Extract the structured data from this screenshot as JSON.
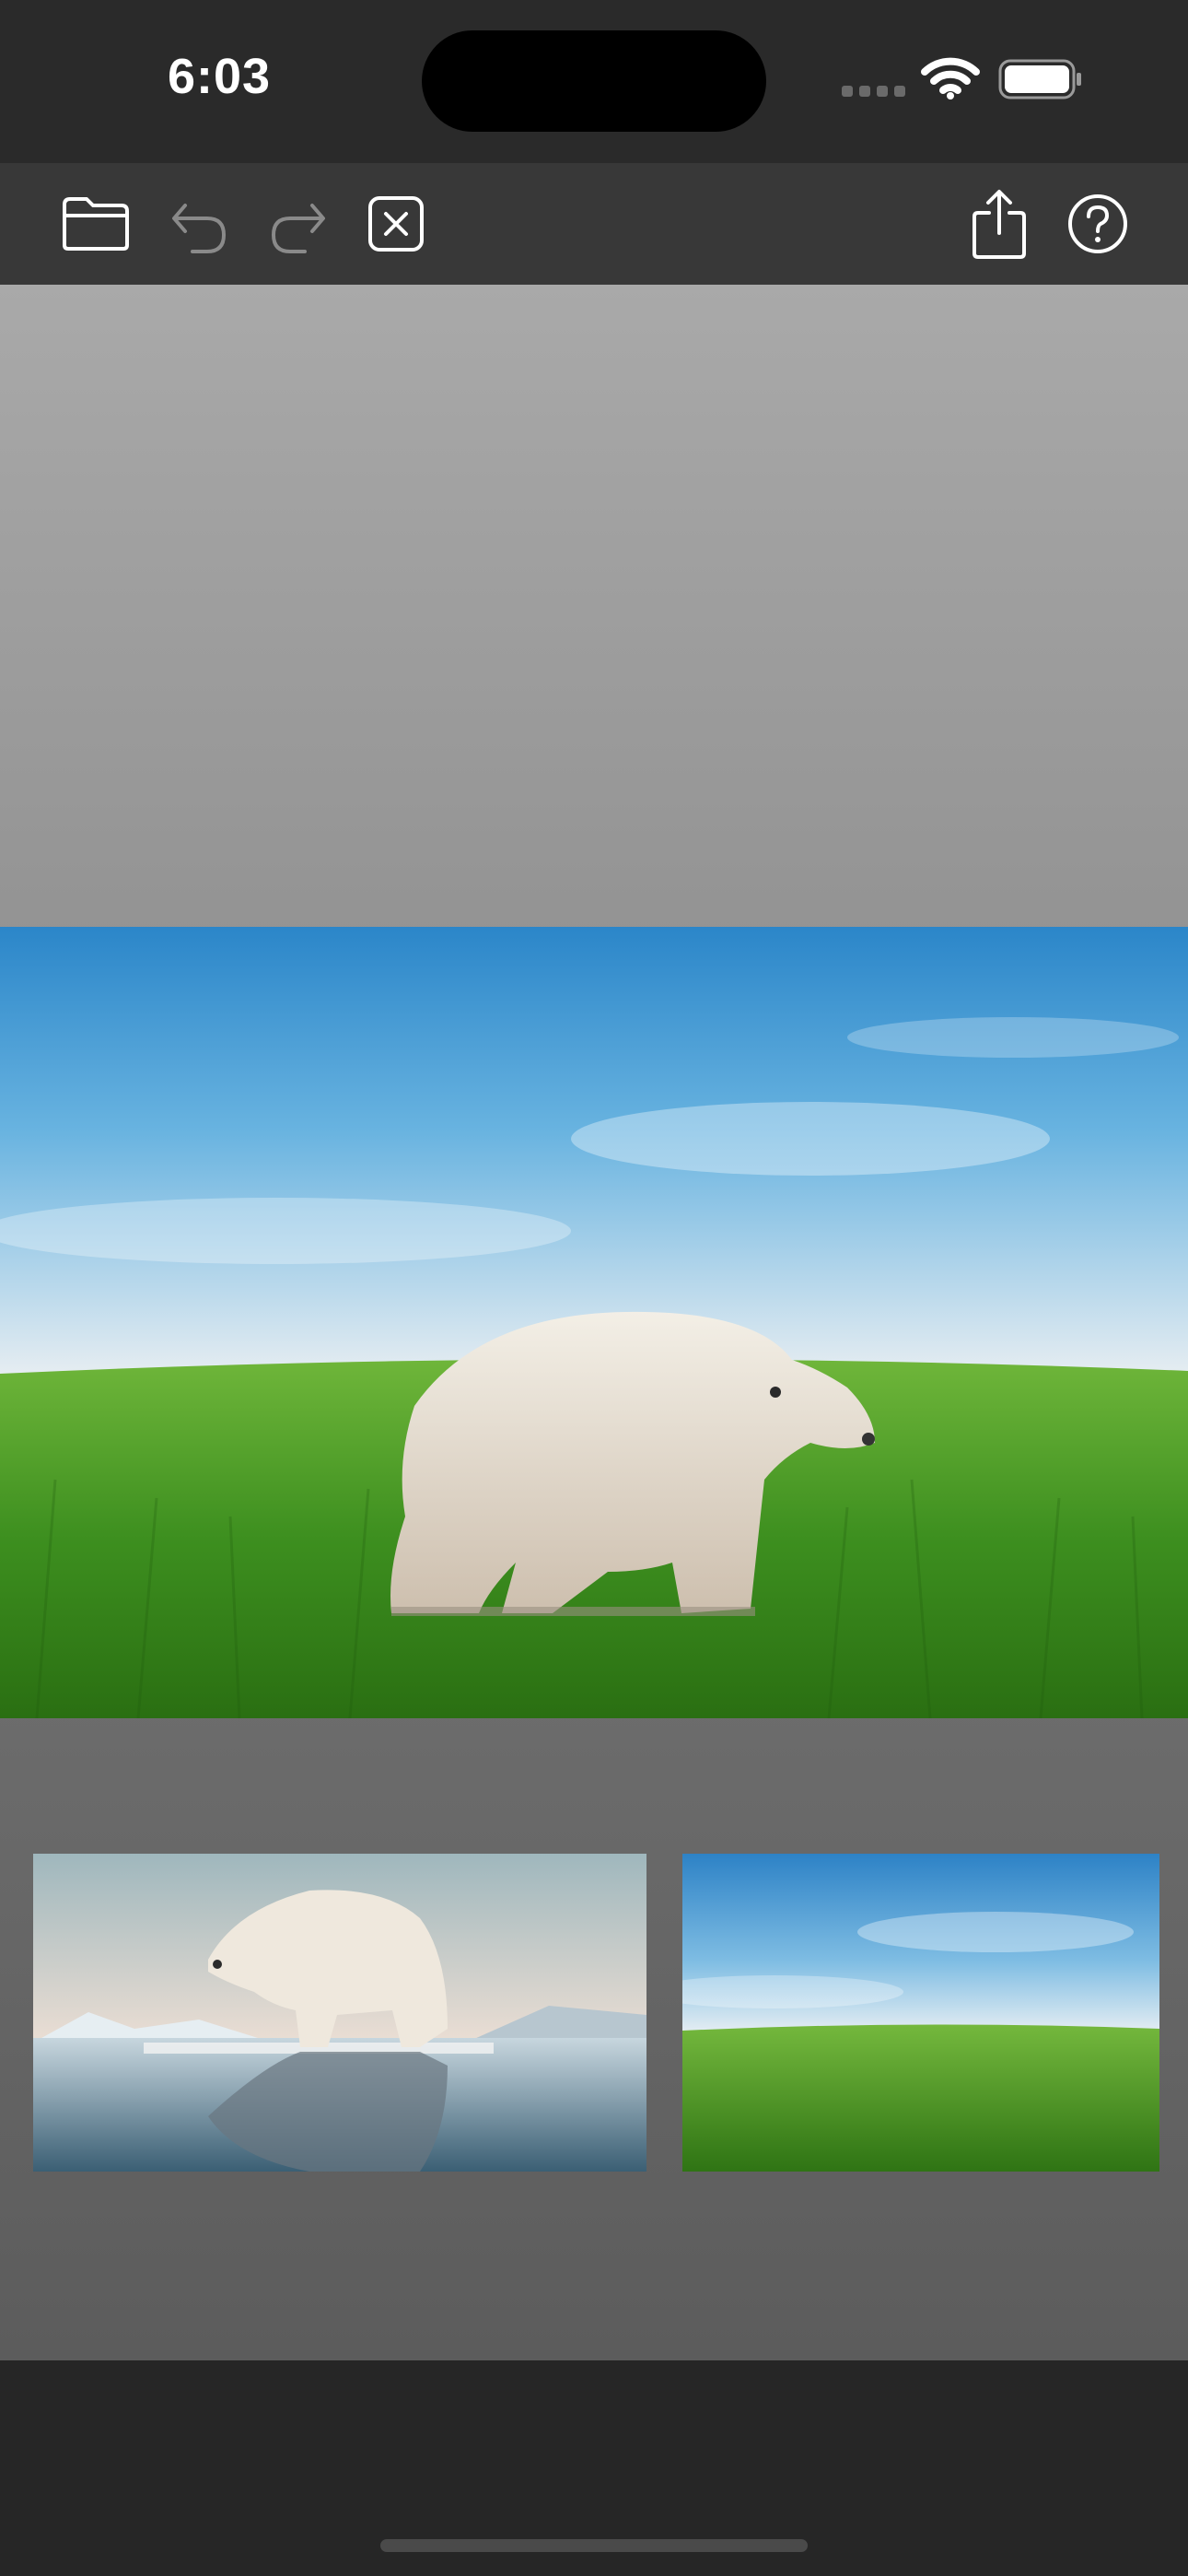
{
  "status_bar": {
    "time": "6:03",
    "icons": [
      "cellular-signal-icon",
      "wifi-icon",
      "battery-icon"
    ]
  },
  "toolbar": {
    "left": [
      "folder-icon",
      "undo-icon",
      "redo-icon",
      "close-box-icon"
    ],
    "right": [
      "share-icon",
      "help-icon"
    ]
  },
  "canvas": {
    "composite_image": "polar-bear-on-grass",
    "thumbnails": [
      "polar-bear-on-ice",
      "grass-field-sky"
    ]
  },
  "colors": {
    "status_bar_bg": "#2a2a2a",
    "toolbar_bg": "#383838",
    "bottom_bg": "#262626",
    "icon_active": "#ffffff",
    "icon_disabled": "#8a8a8a"
  }
}
